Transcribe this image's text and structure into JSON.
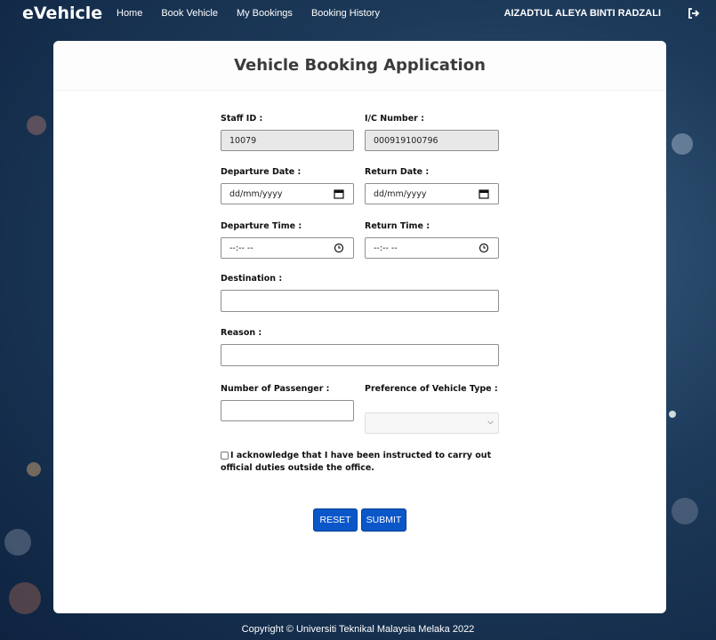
{
  "nav": {
    "brand": "eVehicle",
    "links": [
      "Home",
      "Book Vehicle",
      "My Bookings",
      "Booking History"
    ],
    "user_name": "AIZADTUL ALEYA BINTI RADZALI",
    "logout_icon": "sign-out-icon"
  },
  "form": {
    "title": "Vehicle Booking Application",
    "staff_id": {
      "label": "Staff ID :",
      "value": "10079"
    },
    "ic_number": {
      "label": "I/C Number :",
      "value": "000919100796"
    },
    "departure_date": {
      "label": "Departure Date :",
      "value": "dd/mm/yyyy",
      "icon": "calendar-icon"
    },
    "return_date": {
      "label": "Return Date :",
      "value": "dd/mm/yyyy",
      "icon": "calendar-icon"
    },
    "departure_time": {
      "label": "Departure Time :",
      "value": "--:-- --",
      "icon": "clock-icon"
    },
    "return_time": {
      "label": "Return Time :",
      "value": "--:-- --",
      "icon": "clock-icon"
    },
    "destination": {
      "label": "Destination :",
      "value": ""
    },
    "reason": {
      "label": "Reason :",
      "value": ""
    },
    "passengers": {
      "label": "Number of Passenger :",
      "value": ""
    },
    "vehicle_type": {
      "label": "Preference of Vehicle Type :",
      "value": ""
    },
    "acknowledgement": {
      "text": "I acknowledge that I have been instructed to carry out official duties outside the office.",
      "checked": false
    },
    "reset_label": "RESET",
    "submit_label": "SUBMIT"
  },
  "footer": {
    "copyright": "Copyright © Universiti Teknikal Malaysia Melaka 2022"
  },
  "colors": {
    "button": "#0b57c9",
    "readonly_field": "#e8e8e8",
    "background": "#1d3a5a"
  }
}
